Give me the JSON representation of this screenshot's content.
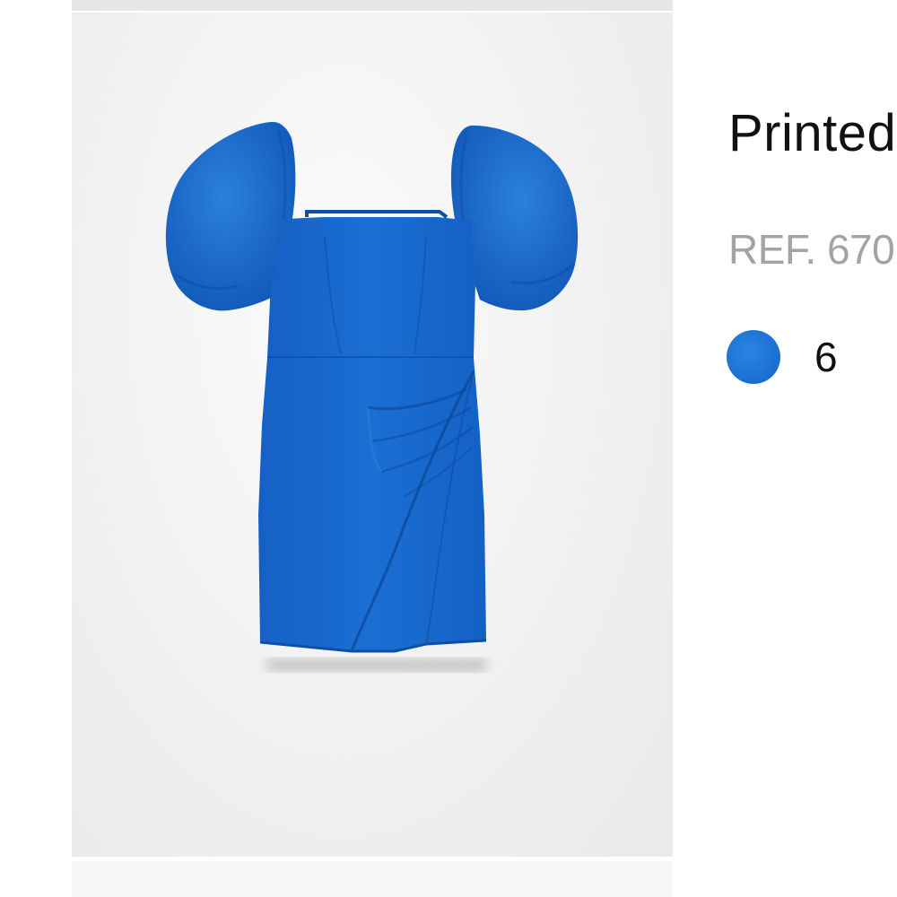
{
  "product": {
    "title": "Printed",
    "ref": "REF. 670",
    "image_alt": "Blue puff-sleeve mini dress with draped skirt"
  },
  "colors": {
    "selected_swatch": "#1a6fd0",
    "selected_count": "6",
    "dress": "#1769cf",
    "dress_shadow": "#0f55ad",
    "dress_highlight": "#2f84e0"
  }
}
